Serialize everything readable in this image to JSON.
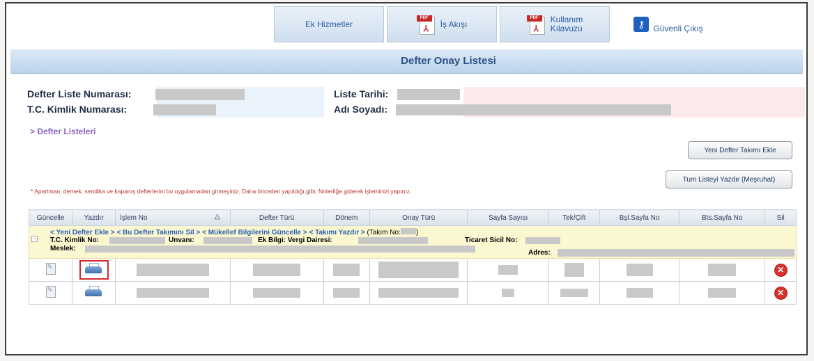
{
  "nav": {
    "ek_hizmetler": "Ek Hizmetler",
    "is_akisi": "İş Akışı",
    "kullanim_line1": "Kullanım",
    "kullanim_line2": "Kılavuzu",
    "guvenli_cikis": "Güvenli Çıkış",
    "pdf_badge": "PDF"
  },
  "page_title": "Defter Onay Listesi",
  "info": {
    "defter_liste_no_label": "Defter Liste Numarası:",
    "liste_tarihi_label": "Liste Tarihi:",
    "tc_kimlik_label": "T.C. Kimlik Numarası:",
    "adi_soyadi_label": "Adı Soyadı:"
  },
  "breadcrumb": "> Defter Listeleri",
  "buttons": {
    "yeni_defter": "Yeni Defter Takımı Ekle",
    "tum_listeyi_yazdir": "Tum Listeyi Yazdır (Meşruhat)"
  },
  "warning": "* Apartman, dernek, sendika ve kapanış defterlerini bu uygulamadan girmeyiniz. Daha önceden yapıldığı gibi, Noterliğe giderek işleminizi yapınız.",
  "table": {
    "headers": [
      "Güncelle",
      "Yazdır",
      "İşlem No",
      "Defter Türü",
      "Dönem",
      "Onay Türü",
      "Sayfa Sayısı",
      "Tek/Çift",
      "Bşl.Sayfa No",
      "Bts.Sayfa No",
      "Sil"
    ],
    "sort_indicator": "△",
    "group": {
      "link_yeni": "< Yeni Defter Ekle >",
      "link_sil": "< Bu Defter Takımını Sil >",
      "link_guncelle": "< Mükellef Bilgilerini Güncelle >",
      "link_yazdir": "< Takımı Yazdır >",
      "takim_no": "(Takım No:",
      "takim_no_close": ")",
      "tc_label": "T.C. Kimlik No:",
      "unvan_label": "Unvanı:",
      "vergi_label": "Ek Bilgi: Vergi Dairesi:",
      "ticaret_label": "Ticaret Sicil No:",
      "meslek_label": "Meslek:",
      "adres_label": "Adres:"
    },
    "delete_symbol": "✕"
  }
}
